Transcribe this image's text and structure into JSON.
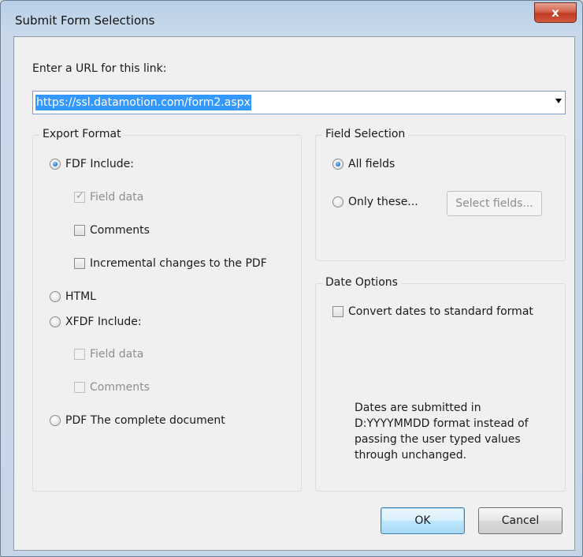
{
  "window": {
    "title": "Submit Form Selections",
    "close_glyph": "x"
  },
  "url": {
    "label": "Enter a URL for this link:",
    "value": "https://ssl.datamotion.com/form2.aspx"
  },
  "export_format": {
    "legend": "Export Format",
    "fdf_label": "FDF  Include:",
    "fdf_options": [
      {
        "label": "Field data",
        "checked": true,
        "disabled": true
      },
      {
        "label": "Comments",
        "checked": false,
        "disabled": false
      },
      {
        "label": "Incremental changes to the PDF",
        "checked": false,
        "disabled": false
      }
    ],
    "html_label": "HTML",
    "xfdf_label": "XFDF  Include:",
    "xfdf_options": [
      {
        "label": "Field data",
        "checked": false,
        "disabled": true
      },
      {
        "label": "Comments",
        "checked": false,
        "disabled": true
      }
    ],
    "pdf_label": "PDF  The complete document",
    "selected": "FDF"
  },
  "field_selection": {
    "legend": "Field Selection",
    "all_fields_label": "All fields",
    "only_these_label": "Only these...",
    "select_fields_button": "Select fields...",
    "selected": "All fields"
  },
  "date_options": {
    "legend": "Date Options",
    "convert_label": "Convert dates to standard format",
    "convert_checked": false,
    "note": "Dates are submitted in D:YYYYMMDD format instead of passing the user typed values through unchanged."
  },
  "buttons": {
    "ok": "OK",
    "cancel": "Cancel"
  }
}
